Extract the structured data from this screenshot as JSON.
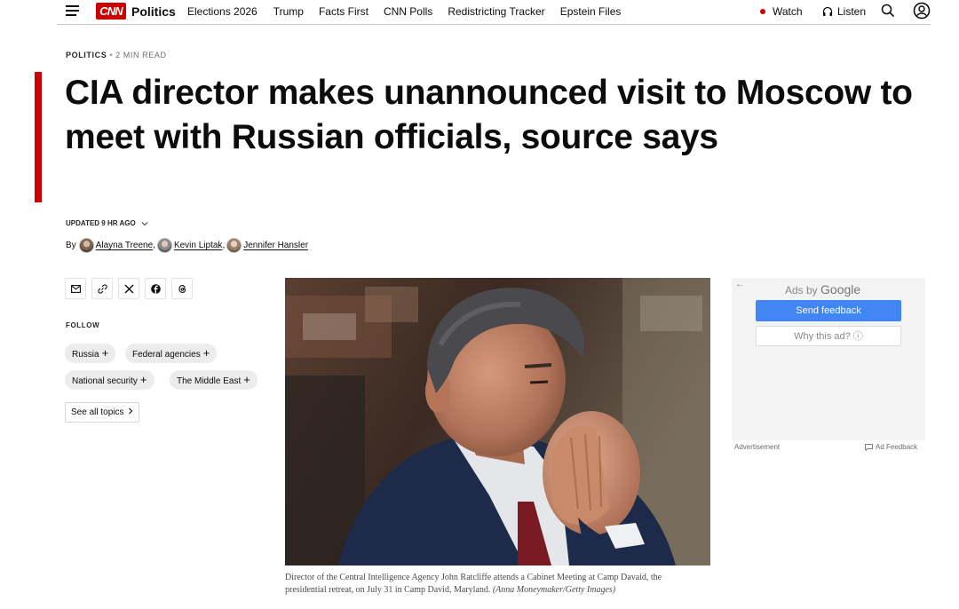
{
  "nav": {
    "logo_text": "CNN",
    "section": "Politics",
    "links": [
      "Elections 2026",
      "Trump",
      "Facts First",
      "CNN Polls",
      "Redistricting Tracker",
      "Epstein Files"
    ],
    "watch_label": "Watch",
    "listen_label": "Listen",
    "icons": [
      "menu-icon",
      "search-icon",
      "user-account-icon",
      "headphones-icon"
    ],
    "colors": {
      "brand_red": "#cc0000",
      "live_dot": "#cc0000"
    }
  },
  "article": {
    "kicker_section": "POLITICS",
    "kicker_separator": "•",
    "kicker_read_time": "2 MIN READ",
    "headline": "CIA director makes unannounced visit to Moscow to meet with Russian officials, source says",
    "updated": "UPDATED 9 HR AGO",
    "byline_prefix": "By",
    "authors": [
      {
        "name": "Alayna Treene"
      },
      {
        "name": "Kevin Liptak"
      },
      {
        "name": "Jennifer Hansler"
      }
    ]
  },
  "share": {
    "buttons": [
      "email-icon",
      "link-icon",
      "x-icon",
      "facebook-icon",
      "threads-icon"
    ]
  },
  "follow": {
    "label": "FOLLOW",
    "topics": [
      "Russia",
      "Federal agencies",
      "National security",
      "The Middle East"
    ],
    "see_all": "See all topics"
  },
  "photo": {
    "caption": "Director of the Central Intelligence Agency John Ratcliffe attends a Cabinet Meeting at Camp Davaid, the presidential retreat, on July 31 in Camp David, Maryland.",
    "credit": "(Anna Moneymaker/Getty Images)"
  },
  "ad": {
    "back_arrow": "←",
    "ads_by": "Ads by",
    "google": "Google",
    "send_feedback": "Send feedback",
    "why_this_ad": "Why this ad? ⓘ",
    "advertisement_label": "Advertisement",
    "ad_feedback_label": "Ad Feedback",
    "colors": {
      "feedback_button": "#4285f4"
    }
  }
}
